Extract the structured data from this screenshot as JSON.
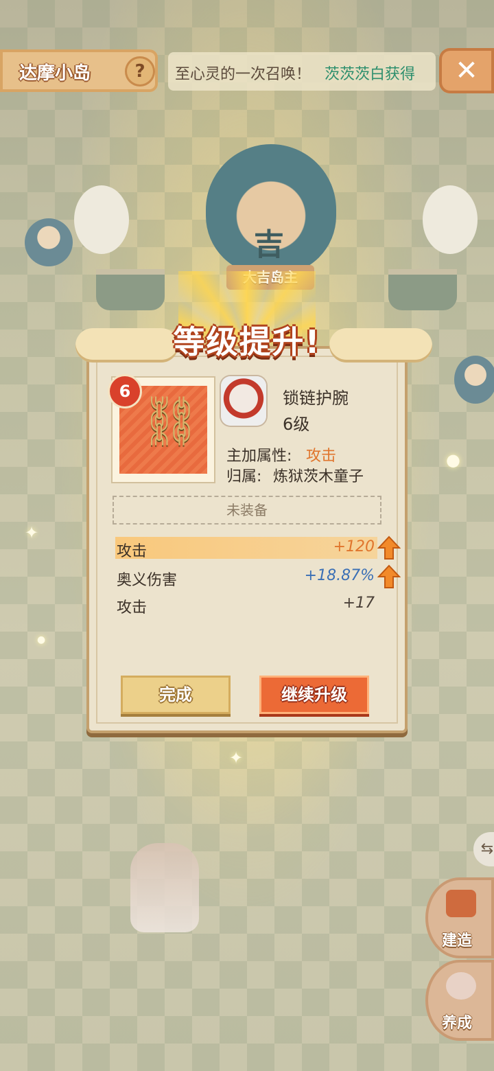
{
  "header": {
    "island_title": "达摩小岛",
    "help_icon": "?",
    "announcement_prefix": "至心灵的一次召唤！",
    "announcement_highlight": "茨茨茨白获得",
    "close_icon": "✕"
  },
  "scene": {
    "daruma_char": "吉",
    "boss_label": "大吉岛主"
  },
  "dialog": {
    "title": "等级提升!",
    "item_level_badge": "6",
    "item_name": "锁链护腕",
    "item_level_text": "6级",
    "main_attr_label": "主加属性:",
    "main_attr_value": "攻击",
    "owner_label": "归属:",
    "owner_value": "炼狱茨木童子",
    "equip_status": "未装备",
    "stats": [
      {
        "label": "攻击",
        "value": "+120",
        "upgraded": true,
        "highlight": true,
        "color": "#e0752d"
      },
      {
        "label": "奥义伤害",
        "value": "+18.87%",
        "upgraded": true,
        "highlight": false,
        "color": "#3a6fb5"
      },
      {
        "label": "攻击",
        "value": "+17",
        "upgraded": false,
        "highlight": false,
        "color": "#4a4038"
      }
    ],
    "done_button": "完成",
    "continue_button": "继续升级"
  },
  "side_menu": {
    "build_label": "建造",
    "raise_label": "养成",
    "build_icon": "build-icon",
    "raise_icon": "raise-icon"
  },
  "colors": {
    "accent_orange": "#ec6a36",
    "gold": "#ecd08a",
    "panel": "#ece3cd"
  }
}
